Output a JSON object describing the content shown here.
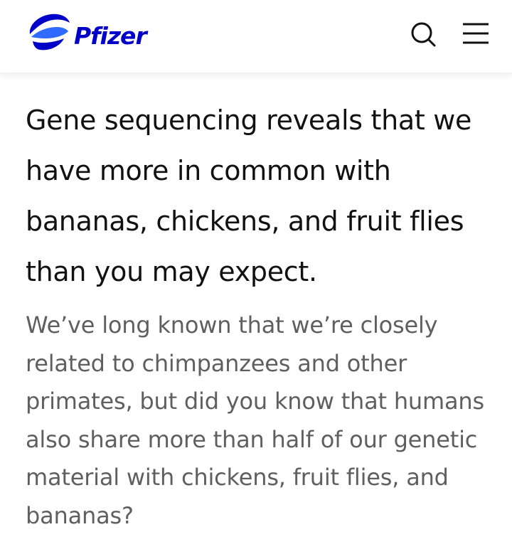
{
  "header": {
    "brand_name": "Pfizer",
    "brand_color": "#0000c9",
    "search_icon": "search-icon",
    "menu_icon": "hamburger-menu-icon"
  },
  "article": {
    "headline": "Gene sequencing reveals that we have more in common with bananas, chickens, and fruit flies than you may expect.",
    "lead": "We’ve long known that we’re closely related to chimpanzees and other primates, but did you know that humans also share more than half of our genetic material with chickens, fruit flies, and bananas?"
  }
}
